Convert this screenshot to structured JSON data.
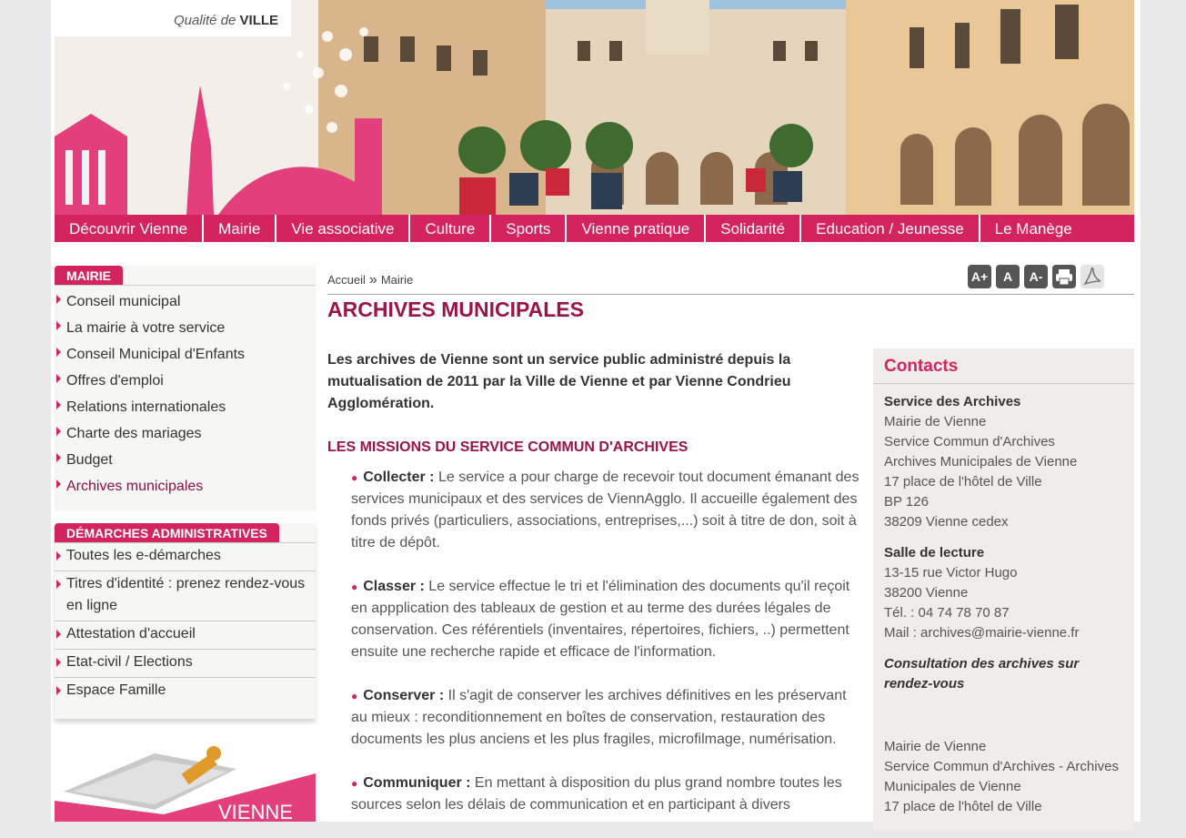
{
  "banner": {
    "tagline_pre": "Qualité de ",
    "tagline_bold": "VILLE"
  },
  "nav": [
    "Découvrir Vienne",
    "Mairie",
    "Vie associative",
    "Culture",
    "Sports",
    "Vienne pratique",
    "Solidarité",
    "Education / Jeunesse",
    "Le Manège"
  ],
  "sidebar": {
    "mairie_title": "MAIRIE",
    "mairie_items": [
      "Conseil municipal",
      "La mairie à votre service",
      "Conseil Municipal d'Enfants",
      "Offres d'emploi",
      "Relations internationales",
      "Charte des mariages",
      "Budget",
      "Archives municipales"
    ],
    "demarches_title": "DÉMARCHES ADMINISTRATIVES",
    "demarches_items": [
      "Toutes les e-démarches",
      "Titres d'identité : prenez rendez-vous en ligne",
      "Attestation d'accueil",
      "Etat-civil / Elections",
      "Espace Famille"
    ],
    "promo_label": "VIENNE"
  },
  "breadcrumb": {
    "home": "Accueil",
    "sep": "»",
    "current": "Mairie"
  },
  "tools": {
    "increase": "A+",
    "normal": "A",
    "decrease": "A-"
  },
  "main": {
    "title": "ARCHIVES MUNICIPALES",
    "intro": "Les archives de Vienne sont un service public administré depuis la mutualisation de 2011 par la Ville de Vienne et par Vienne Condrieu Agglomération.",
    "missions_title": "LES MISSIONS DU SERVICE COMMUN D'ARCHIVES",
    "missions": [
      {
        "label": "Collecter :",
        "text": " Le service a pour charge de recevoir tout document émanant des services municipaux et des services de ViennAgglo. Il accueille également des fonds privés (particuliers, associations, entreprises,...) soit à titre de don, soit à titre de dépôt."
      },
      {
        "label": "Classer :",
        "text": " Le service effectue le tri et l'élimination des documents qu'il reçoit en appplication des tableaux de gestion et au terme des durées légales de conservation. Ces référentiels (inventaires, répertoires, fichiers, ..) permettent ensuite une recherche rapide et efficace de l'information."
      },
      {
        "label": "Conserver :",
        "text": " Il s'agit de conserver les archives définitives en les préservant au mieux : reconditionnement en boîtes de conservation, restauration des documents les plus anciens et les plus fragiles, microfilmage, numérisation."
      },
      {
        "label": "Communiquer :",
        "text": " En mettant à disposition du plus grand nombre toutes les sources selon les délais de communication et en participant à divers"
      }
    ]
  },
  "contacts": {
    "title": "Contacts",
    "service_title": "Service des Archives",
    "service_lines": [
      "Mairie de Vienne",
      "Service Commun d'Archives",
      "Archives Municipales de Vienne",
      "17 place de l'hôtel de Ville",
      "BP 126",
      "38209 Vienne cedex"
    ],
    "salle_title": "Salle de lecture",
    "salle_lines": [
      "13-15 rue Victor Hugo",
      "38200 Vienne",
      "Tél. : 04 74 78 70 87",
      "Mail : archives@mairie-vienne.fr"
    ],
    "consult": "Consultation des archives sur rendez-vous",
    "footer_lines": [
      "Mairie de Vienne",
      "Service Commun d'Archives - Archives Municipales de Vienne",
      "17 place de l'hôtel de Ville"
    ]
  }
}
